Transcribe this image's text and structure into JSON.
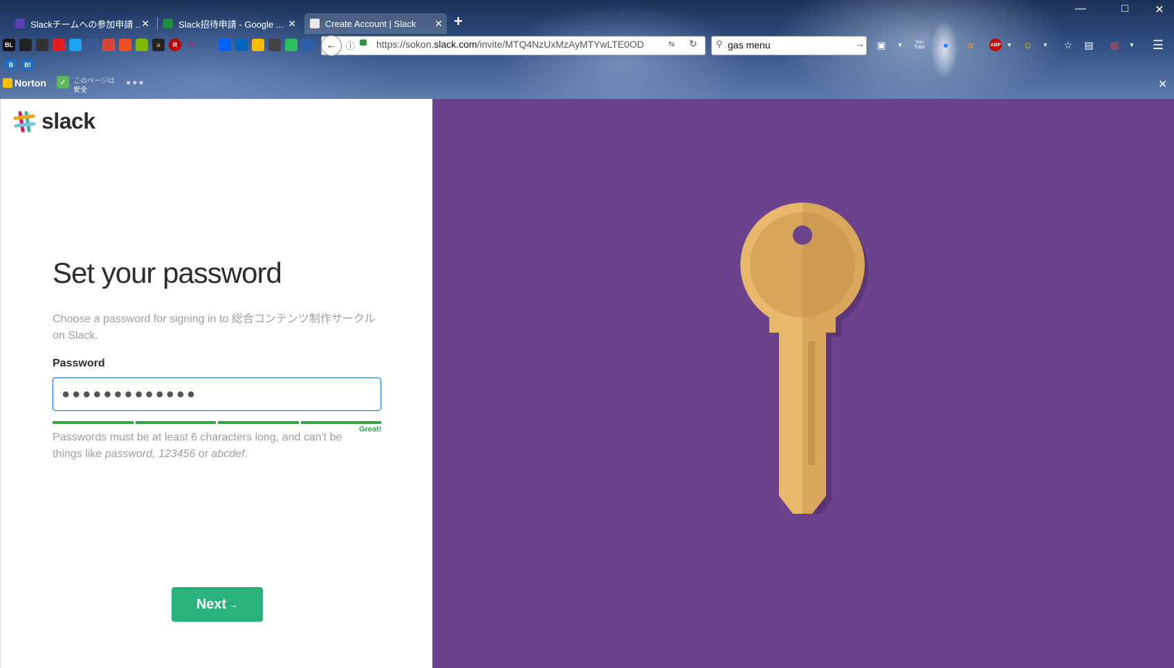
{
  "browser": {
    "tabs": [
      {
        "label": "Slackチームへの参加申請 ...",
        "favicon_color": "#5b3fb8",
        "active": false
      },
      {
        "label": "Slack招待申請 - Google ...",
        "favicon_color": "#1e8e3e",
        "active": false
      },
      {
        "label": "Create Account | Slack",
        "favicon_color": "#e8e8e8",
        "active": true
      }
    ],
    "url": {
      "prefix": "https://sokon.",
      "domain": "slack.com",
      "path": "/invite/MTQ4NzUxMzAyMTYwLTE0OD"
    },
    "search": {
      "value": "gas menu"
    },
    "bookmarks": [
      "BL",
      "",
      "",
      "",
      "",
      "",
      "",
      "",
      "a",
      "R",
      "Y!",
      "",
      "",
      "",
      "",
      "",
      "",
      ""
    ],
    "toolbar_badges": {
      "abp": "ABP",
      "youtube": "You Tube"
    },
    "row3": [
      "B",
      "B!"
    ],
    "norton": {
      "label": "Norton",
      "safe_line1": "このページは",
      "safe_line2": "安全"
    }
  },
  "page": {
    "logo_text": "slack",
    "title": "Set your password",
    "subtitle": "Choose a password for signing in to 総合コンテンツ制作サークル on Slack.",
    "password_label": "Password",
    "password_mask": "●●●●●●●●●●●●●",
    "strength_label": "Great!",
    "hint_pre": "Passwords must be at least 6 characters long, and can't be things like ",
    "hint_ex1": "password",
    "hint_sep1": ", ",
    "hint_ex2": "123456",
    "hint_sep2": " or ",
    "hint_ex3": "abcdef",
    "hint_end": ".",
    "next_label": "Next",
    "next_arrow": "→"
  },
  "colors": {
    "purple": "#6b428c",
    "next_green": "#2ab27b",
    "strength_green": "#34a344",
    "key_gold": "#e8b86d"
  }
}
